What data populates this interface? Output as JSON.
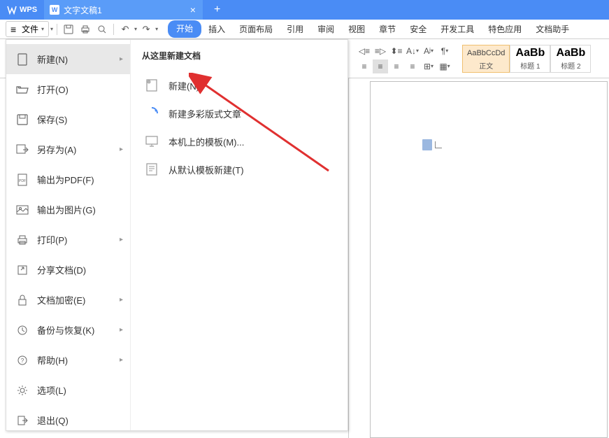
{
  "title_bar": {
    "app_name": "WPS",
    "doc_tab": "文字文稿1"
  },
  "toolbar": {
    "file_label": "文件"
  },
  "ribbon_tabs": {
    "start": "开始",
    "insert": "插入",
    "page_layout": "页面布局",
    "reference": "引用",
    "review": "审阅",
    "view": "视图",
    "section": "章节",
    "security": "安全",
    "dev_tools": "开发工具",
    "special": "特色应用",
    "assistant": "文档助手"
  },
  "styles": {
    "normal": {
      "preview": "AaBbCcDd",
      "label": "正文"
    },
    "heading1": {
      "preview": "AaBb",
      "label": "标题 1"
    },
    "heading2": {
      "preview": "AaBb",
      "label": "标题 2"
    }
  },
  "file_menu": {
    "items": {
      "new": "新建(N)",
      "open": "打开(O)",
      "save": "保存(S)",
      "save_as": "另存为(A)",
      "export_pdf": "输出为PDF(F)",
      "export_image": "输出为图片(G)",
      "print": "打印(P)",
      "share": "分享文档(D)",
      "encrypt": "文档加密(E)",
      "backup": "备份与恢复(K)",
      "help": "帮助(H)",
      "options": "选项(L)",
      "exit": "退出(Q)"
    },
    "submenu": {
      "title": "从这里新建文档",
      "new_blank": "新建(N)",
      "new_colorful": "新建多彩版式文章",
      "local_template": "本机上的模板(M)...",
      "default_template": "从默认模板新建(T)"
    }
  }
}
